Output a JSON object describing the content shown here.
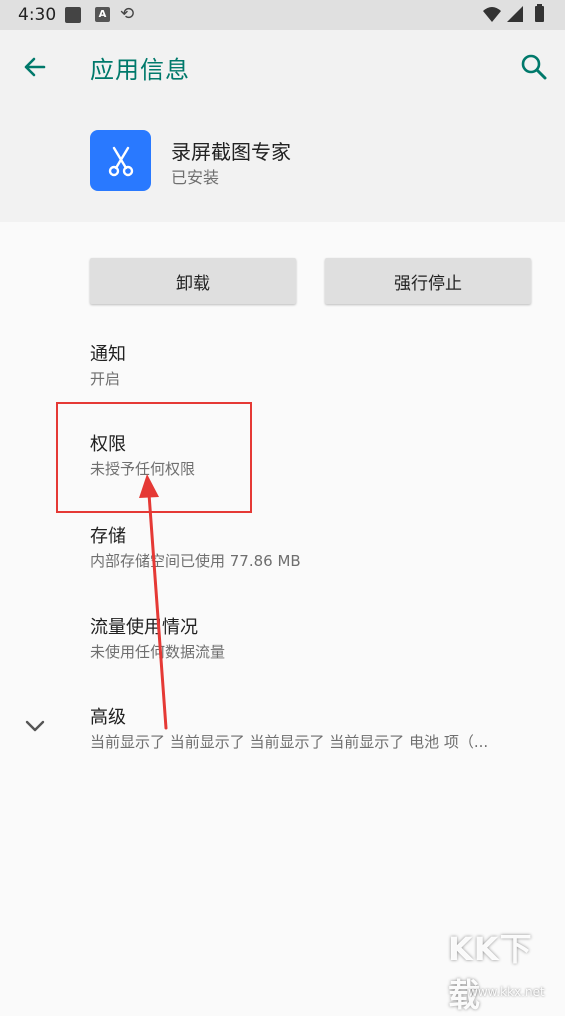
{
  "status_bar": {
    "time": "4:30",
    "a_badge": "A"
  },
  "header": {
    "title": "应用信息"
  },
  "app": {
    "name": "录屏截图专家",
    "install_status": "已安装",
    "icon_color": "#2979ff"
  },
  "buttons": {
    "uninstall": "卸载",
    "force_stop": "强行停止"
  },
  "items": [
    {
      "title": "通知",
      "subtitle": "开启"
    },
    {
      "title": "权限",
      "subtitle": "未授予任何权限"
    },
    {
      "title": "存储",
      "subtitle": "内部存储空间已使用 77.86 MB"
    },
    {
      "title": "流量使用情况",
      "subtitle": "未使用任何数据流量"
    },
    {
      "title": "高级",
      "subtitle": "当前显示了 当前显示了 当前显示了 当前显示了 电池 项（..."
    }
  ],
  "colors": {
    "accent": "#00796b",
    "annotation": "#e53935"
  },
  "watermark": {
    "logo": "KK下载",
    "url": "www.kkx.net"
  }
}
